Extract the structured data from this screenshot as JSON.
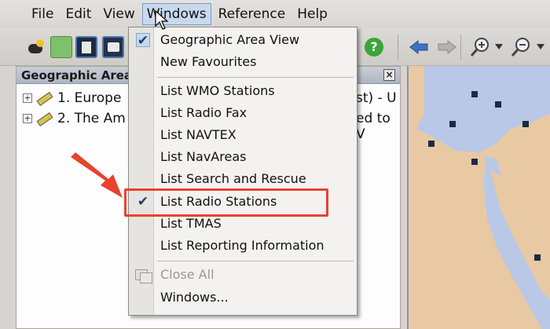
{
  "menubar": {
    "items": [
      {
        "label": "File"
      },
      {
        "label": "Edit"
      },
      {
        "label": "View"
      },
      {
        "label": "Windows"
      },
      {
        "label": "Reference"
      },
      {
        "label": "Help"
      }
    ]
  },
  "panel": {
    "title": "Geographic Area",
    "close_label": "×",
    "tree": [
      {
        "expander": "+",
        "label": "1. Europe",
        "tail": "st) - U"
      },
      {
        "expander": "+",
        "label": "2. The Am",
        "tail": "ed to V"
      }
    ]
  },
  "toolbar": {
    "help_label": "?"
  },
  "windows_menu": {
    "items": [
      {
        "label": "Geographic Area View",
        "checked": true
      },
      {
        "label": "New Favourites",
        "checked": false
      },
      {
        "label": "List WMO Stations",
        "checked": false
      },
      {
        "label": "List Radio Fax",
        "checked": false
      },
      {
        "label": "List NAVTEX",
        "checked": false
      },
      {
        "label": "List NavAreas",
        "checked": false
      },
      {
        "label": "List Search and Rescue",
        "checked": false
      },
      {
        "label": "List Radio Stations",
        "checked": true
      },
      {
        "label": "List TMAS",
        "checked": false
      },
      {
        "label": "List Reporting Information",
        "checked": false
      },
      {
        "label": "Close All",
        "disabled": true
      },
      {
        "label": "Windows..."
      }
    ],
    "check_glyph": "✔"
  },
  "colors": {
    "highlight": "#e8432c",
    "menu_active": "#c8d9ee",
    "map_land": "#e8c9a3",
    "map_sea": "#b8c8e6"
  }
}
